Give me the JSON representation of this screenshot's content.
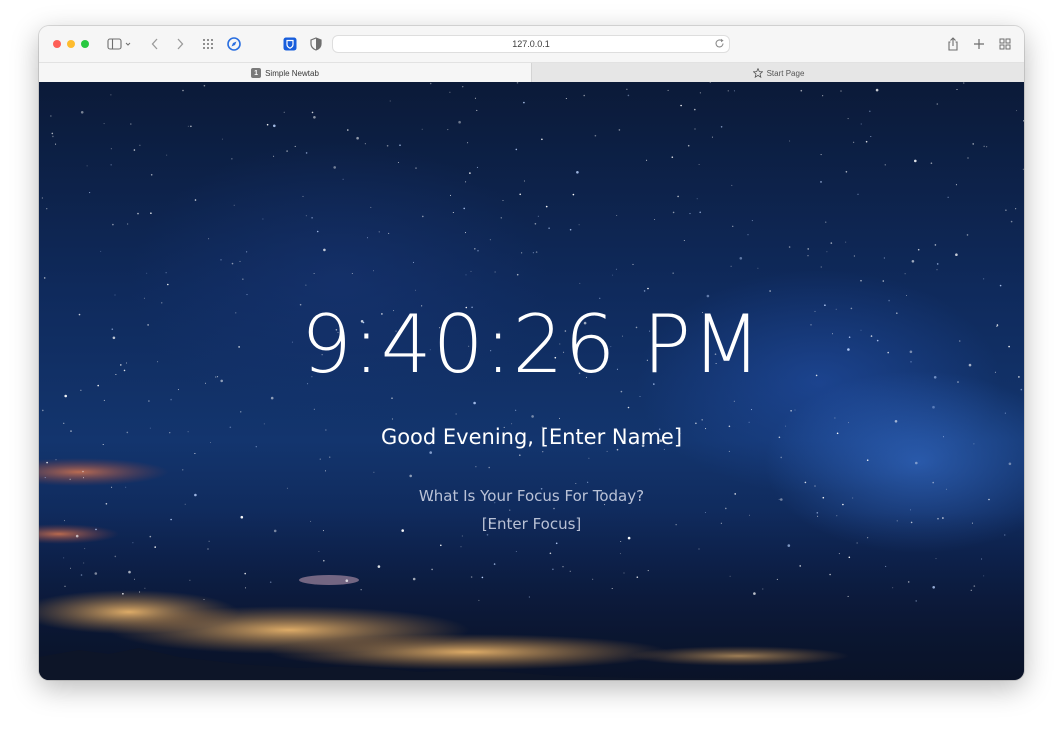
{
  "browser": {
    "address": "127.0.0.1",
    "tabs": [
      {
        "label": "Simple Newtab",
        "badge": "1",
        "active": true
      },
      {
        "label": "Start Page",
        "active": false
      }
    ],
    "icons": {
      "sidebar": "sidebar-icon",
      "back": "chevron-left-icon",
      "forward": "chevron-right-icon",
      "grid": "grid-dots-icon",
      "compass": "compass-icon",
      "bitwarden": "bitwarden-shield-icon",
      "privacy": "shield-half-icon",
      "reload": "reload-icon",
      "share": "share-icon",
      "new_tab": "plus-icon",
      "tab_overview": "tab-overview-icon",
      "star": "star-icon"
    }
  },
  "page": {
    "clock": "9:40:26 PM",
    "greeting": "Good Evening, [Enter Name]",
    "focus_question": "What Is Your Focus For Today?",
    "focus_value": "[Enter Focus]"
  }
}
